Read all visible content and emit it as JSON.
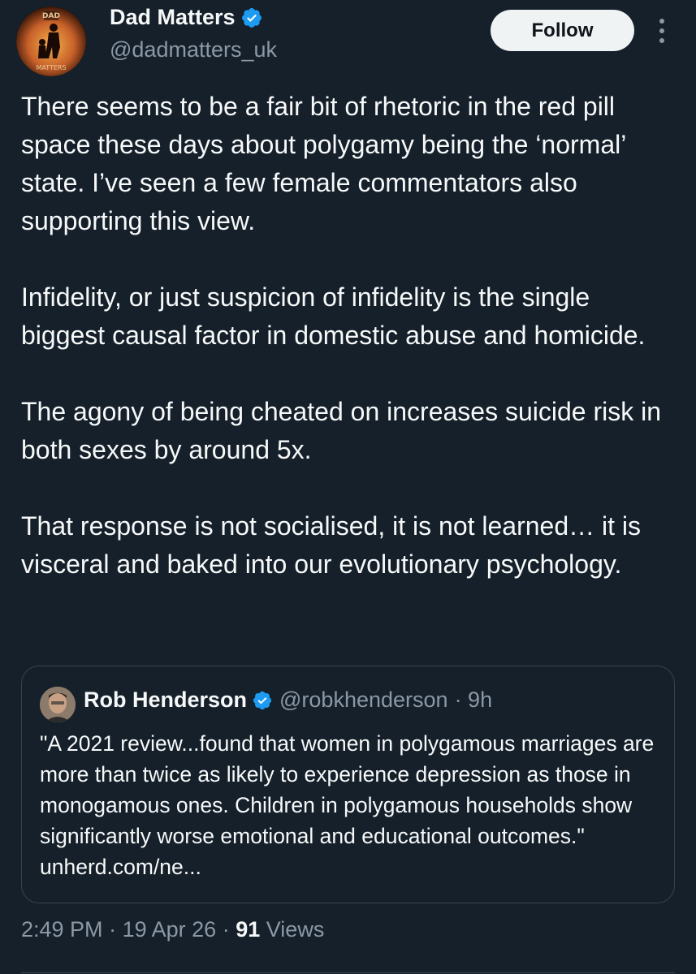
{
  "author": {
    "display_name": "Dad Matters",
    "handle": "@dadmatters_uk",
    "avatar_text_top": "DAD",
    "avatar_text_bottom": "MATTERS"
  },
  "follow_label": "Follow",
  "tweet_paragraphs": [
    "There seems to be a fair bit of rhetoric in the red pill space these days about polygamy being the ‘normal’ state. I’ve seen a few female commentators also supporting this view.",
    "Infidelity, or just suspicion of infidelity is the single biggest causal factor in domestic abuse and homicide.",
    "The agony of being cheated on increases suicide risk in both sexes by around 5x.",
    "That response is not socialised, it is not learned… it is visceral and baked into our evolutionary psychology."
  ],
  "quote": {
    "display_name": "Rob Henderson",
    "handle": "@robkhenderson",
    "time": "· 9h",
    "text": "\"A 2021 review...found that women in polygamous marriages are more than twice as likely to experience depression as those in monogamous ones. Children in polygamous households show significantly worse emotional and educational outcomes.\" unherd.com/ne..."
  },
  "meta": {
    "time": "2:49 PM",
    "sep1": "·",
    "date": "19 Apr 26",
    "sep2": "·",
    "views_count": "91",
    "views_label": "Views"
  },
  "colors": {
    "background": "#15202b",
    "verified": "#1d9bf0",
    "secondary_text": "#8b98a5"
  }
}
